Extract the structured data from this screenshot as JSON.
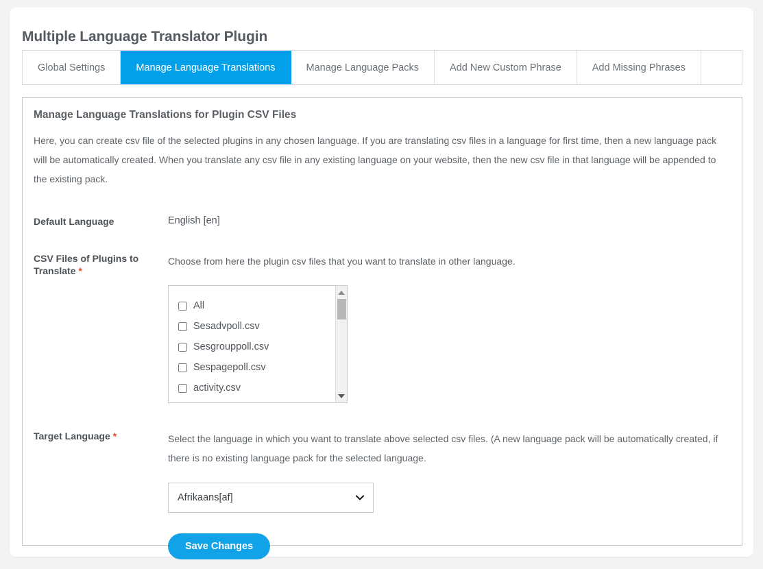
{
  "page": {
    "title": "Multiple Language Translator Plugin"
  },
  "tabs": [
    {
      "label": "Global Settings",
      "active": false
    },
    {
      "label": "Manage Language Translations",
      "active": true
    },
    {
      "label": "Manage Language Packs",
      "active": false
    },
    {
      "label": "Add New Custom Phrase",
      "active": false
    },
    {
      "label": "Add Missing Phrases",
      "active": false
    }
  ],
  "panel": {
    "title": "Manage Language Translations for Plugin CSV Files",
    "description": "Here, you can create csv file of the selected plugins in any chosen language. If you are translating csv files in a language for first time, then a new language pack will be automatically created. When you translate any csv file in any existing language on your website, then the new csv file in that language will be appended to the existing pack."
  },
  "form": {
    "default_language": {
      "label": "Default Language",
      "value": "English [en]"
    },
    "csv_files": {
      "label": "CSV Files of Plugins to Translate",
      "required_marker": "*",
      "help": "Choose from here the plugin csv files that you want to translate in other language.",
      "options": [
        {
          "label": "All",
          "checked": false
        },
        {
          "label": "Sesadvpoll.csv",
          "checked": false
        },
        {
          "label": "Sesgrouppoll.csv",
          "checked": false
        },
        {
          "label": "Sespagepoll.csv",
          "checked": false
        },
        {
          "label": "activity.csv",
          "checked": false
        }
      ]
    },
    "target_language": {
      "label": "Target Language",
      "required_marker": "*",
      "help": "Select the language in which you want to translate above selected csv files. (A new language pack will be automatically created, if there is no existing language pack for the selected language.",
      "selected": "Afrikaans[af]",
      "options": [
        "Afrikaans[af]"
      ]
    },
    "save_label": "Save Changes"
  },
  "colors": {
    "accent": "#02a0e8",
    "button": "#11a2e8",
    "required": "#e8492b",
    "page_bg": "#f3f3f4"
  }
}
